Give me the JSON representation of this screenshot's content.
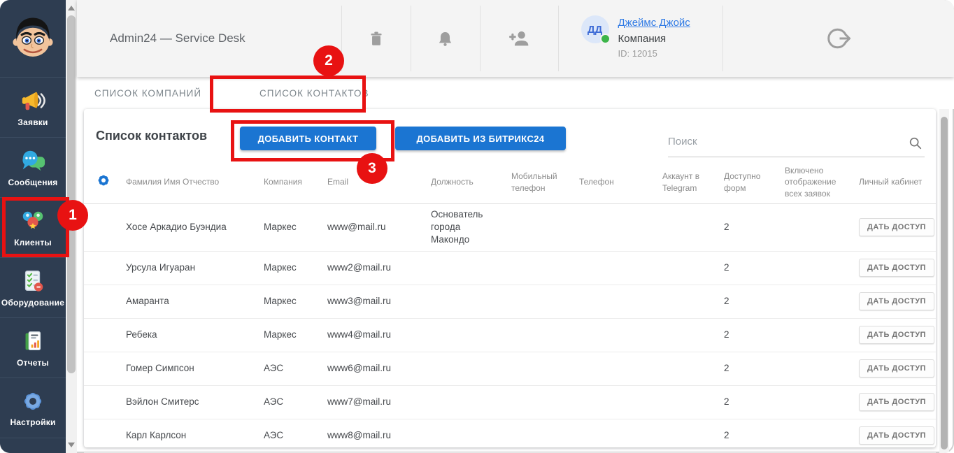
{
  "header": {
    "title": "Admin24 — Service Desk",
    "user": {
      "initials": "ДД",
      "name": "Джеймс Джойс",
      "company": "Компания",
      "id": "ID: 12015"
    }
  },
  "sidebar": {
    "items": [
      {
        "label": "Заявки",
        "icon": "megaphone-icon"
      },
      {
        "label": "Сообщения",
        "icon": "chat-icon"
      },
      {
        "label": "Клиенты",
        "icon": "clients-icon"
      },
      {
        "label": "Оборудование",
        "icon": "equipment-icon"
      },
      {
        "label": "Отчеты",
        "icon": "reports-icon"
      },
      {
        "label": "Настройки",
        "icon": "gear-icon"
      }
    ]
  },
  "tabs": {
    "companies": "СПИСОК КОМПАНИЙ",
    "contacts": "СПИСОК КОНТАКТОВ"
  },
  "panel": {
    "title": "Список контактов",
    "add_contact_label": "ДОБАВИТЬ КОНТАКТ",
    "add_bitrix_label": "ДОБАВИТЬ ИЗ БИТРИКС24",
    "search": {
      "placeholder": "Поиск"
    },
    "table": {
      "columns": [
        "Фамилия Имя Отчество",
        "Компания",
        "Email",
        "Должность",
        "Мобильный телефон",
        "Телефон",
        "Аккаунт в Telegram",
        "Доступно форм",
        "Включено отображение всех заявок",
        "Личный кабинет"
      ],
      "access_button_label": "ДАТЬ ДОСТУП",
      "rows": [
        {
          "name": "Хосе Аркадио Буэндиа",
          "company": "Маркес",
          "email": "www@mail.ru",
          "position": "Основатель города Макондо",
          "mobile": "",
          "phone": "",
          "telegram": "",
          "forms": "2",
          "display_all_enabled": true
        },
        {
          "name": "Урсула Игуаран",
          "company": "Маркес",
          "email": "www2@mail.ru",
          "position": "",
          "mobile": "",
          "phone": "",
          "telegram": "",
          "forms": "2",
          "display_all_enabled": true
        },
        {
          "name": "Амаранта",
          "company": "Маркес",
          "email": "www3@mail.ru",
          "position": "",
          "mobile": "",
          "phone": "",
          "telegram": "",
          "forms": "2",
          "display_all_enabled": true
        },
        {
          "name": "Ребека",
          "company": "Маркес",
          "email": "www4@mail.ru",
          "position": "",
          "mobile": "",
          "phone": "",
          "telegram": "",
          "forms": "2",
          "display_all_enabled": true
        },
        {
          "name": "Гомер Симпсон",
          "company": "АЭС",
          "email": "www6@mail.ru",
          "position": "",
          "mobile": "",
          "phone": "",
          "telegram": "",
          "forms": "2",
          "display_all_enabled": true
        },
        {
          "name": "Вэйлон Смитерс",
          "company": "АЭС",
          "email": "www7@mail.ru",
          "position": "",
          "mobile": "",
          "phone": "",
          "telegram": "",
          "forms": "2",
          "display_all_enabled": true
        },
        {
          "name": "Карл Карлсон",
          "company": "АЭС",
          "email": "www8@mail.ru",
          "position": "",
          "mobile": "",
          "phone": "",
          "telegram": "",
          "forms": "2",
          "display_all_enabled": true
        }
      ]
    }
  },
  "annotations": {
    "badges": [
      "1",
      "2",
      "3"
    ]
  },
  "colors": {
    "sidebar": "#2e3d51",
    "accent_blue": "#1b75d2",
    "annotation_red": "#e81212",
    "link_blue": "#2f7ae5",
    "status_green": "#3cb54a"
  }
}
